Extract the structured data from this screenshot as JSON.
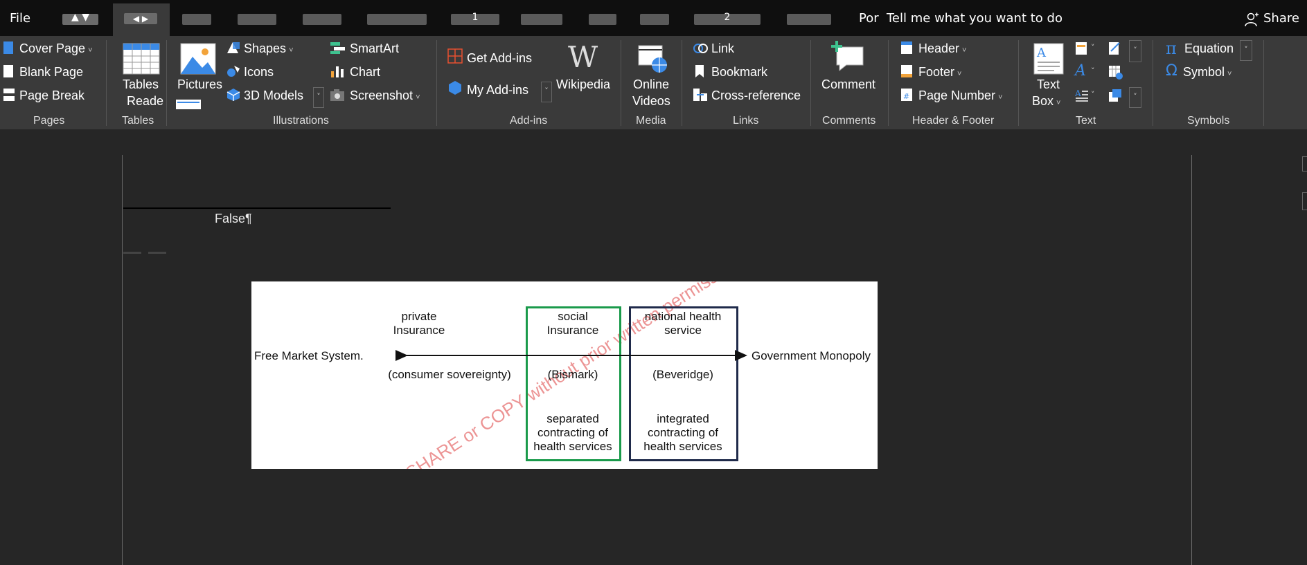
{
  "titlebar": {
    "file_label": "File",
    "por_label": "Por",
    "tell_me": "Tell me what you want to do",
    "share_label": "Share",
    "ruler_numbers": [
      "1",
      "2"
    ]
  },
  "ribbon": {
    "pages": {
      "cover_page": "Cover Page",
      "blank_page": "Blank Page",
      "page_break": "Page Break",
      "group": "Pages"
    },
    "tables": {
      "label_top": "Tables",
      "label_sub": "Reade",
      "group": "Tables"
    },
    "illustrations": {
      "pictures": "Pictures",
      "shapes": "Shapes",
      "icons": "Icons",
      "models": "3D Models",
      "smartart": "SmartArt",
      "chart": "Chart",
      "screenshot": "Screenshot",
      "group": "Illustrations"
    },
    "addins": {
      "get": "Get Add-ins",
      "my": "My Add-ins",
      "wikipedia": "Wikipedia",
      "group": "Add-ins"
    },
    "media": {
      "online_line1": "Online",
      "online_line2": "Videos",
      "group": "Media"
    },
    "links": {
      "link": "Link",
      "bookmark": "Bookmark",
      "cross_reference": "Cross-reference",
      "group": "Links"
    },
    "comments": {
      "comment": "Comment",
      "group": "Comments"
    },
    "header_footer": {
      "header": "Header",
      "footer": "Footer",
      "page_number": "Page Number",
      "group": "Header & Footer"
    },
    "text": {
      "textbox_line1": "Text",
      "textbox_line2": "Box",
      "group": "Text"
    },
    "symbols": {
      "equation": "Equation",
      "symbol": "Symbol",
      "group": "Symbols"
    }
  },
  "document": {
    "false_para": "False¶"
  },
  "figure": {
    "left_end": "Free Market System.",
    "right_end": "Government Monopoly",
    "col1_title": "private\nInsurance",
    "col1_sub": "(consumer sovereignty)",
    "col2_title": "social\nInsurance",
    "col2_sub": "(Bismark)",
    "col2_bottom": "separated\ncontracting of\nhealth services",
    "col3_title": "national health\nservice",
    "col3_sub": "(Beveridge)",
    "col3_bottom": "integrated\ncontracting of\nhealth services",
    "watermark": "SHARE or COPY without prior written permission"
  },
  "colors": {
    "green_box": "#1a9a4b",
    "navy_box": "#1f2a4a",
    "watermark": "#dc3c3c",
    "accent_blue": "#3b8ae6"
  }
}
